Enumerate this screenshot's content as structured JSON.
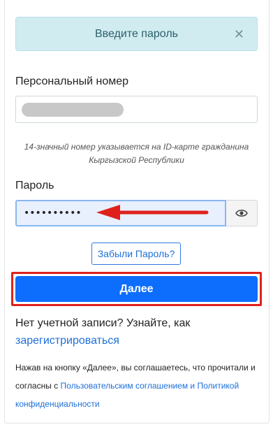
{
  "alert": {
    "text": "Введите пароль",
    "close_icon": "close-icon"
  },
  "personal_number": {
    "label": "Персональный номер",
    "value_redacted": true,
    "hint": "14-значный номер указывается на ID-карте гражданина Кыргызской Республики"
  },
  "password": {
    "label": "Пароль",
    "value": "••••••••••",
    "toggle_icon": "eye-icon"
  },
  "annotation": {
    "arrow_color": "#e0211b",
    "highlight_color": "#e0211b"
  },
  "forgot_password": {
    "label": "Забыли Пароль?"
  },
  "next_button": {
    "label": "Далее",
    "color": "#0d6efd"
  },
  "register": {
    "prefix": "Нет учетной записи? Узнайте, как ",
    "link": "зарегистрироваться"
  },
  "terms": {
    "prefix": "Нажав на кнопку «Далее», вы соглашаетесь, что прочитали и согласны с ",
    "link": "Пользовательским соглашением и Политикой конфиденциальности"
  }
}
